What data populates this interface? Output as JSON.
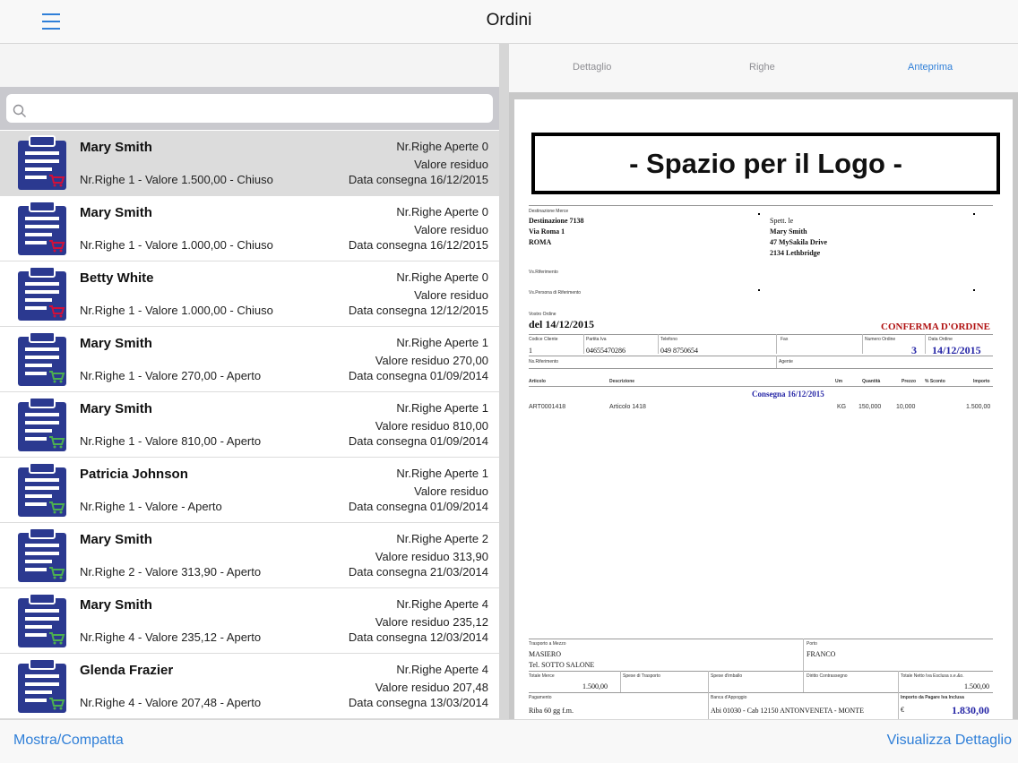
{
  "nav": {
    "title": "Ordini"
  },
  "search": {
    "placeholder": ""
  },
  "orders": [
    {
      "name": "Mary Smith",
      "righe_aperte": "Nr.Righe Aperte 0",
      "residuo": "Valore residuo",
      "summary": "Nr.Righe 1 - Valore 1.500,00 - Chiuso",
      "consegna": "Data consegna 16/12/2015",
      "status": "closed",
      "selected": true
    },
    {
      "name": "Mary Smith",
      "righe_aperte": "Nr.Righe Aperte 0",
      "residuo": "Valore residuo",
      "summary": "Nr.Righe 1 - Valore 1.000,00 - Chiuso",
      "consegna": "Data consegna 16/12/2015",
      "status": "closed",
      "selected": false
    },
    {
      "name": "Betty White",
      "righe_aperte": "Nr.Righe Aperte 0",
      "residuo": "Valore residuo",
      "summary": "Nr.Righe 1 - Valore 1.000,00 - Chiuso",
      "consegna": "Data consegna 12/12/2015",
      "status": "closed",
      "selected": false
    },
    {
      "name": "Mary Smith",
      "righe_aperte": "Nr.Righe Aperte 1",
      "residuo": "Valore residuo 270,00",
      "summary": "Nr.Righe 1 - Valore 270,00 - Aperto",
      "consegna": "Data consegna 01/09/2014",
      "status": "open",
      "selected": false
    },
    {
      "name": "Mary Smith",
      "righe_aperte": "Nr.Righe Aperte 1",
      "residuo": "Valore residuo 810,00",
      "summary": "Nr.Righe 1 - Valore 810,00 - Aperto",
      "consegna": "Data consegna 01/09/2014",
      "status": "open",
      "selected": false
    },
    {
      "name": "Patricia Johnson",
      "righe_aperte": "Nr.Righe Aperte 1",
      "residuo": "Valore residuo",
      "summary": "Nr.Righe 1 - Valore  - Aperto",
      "consegna": "Data consegna 01/09/2014",
      "status": "open",
      "selected": false
    },
    {
      "name": "Mary Smith",
      "righe_aperte": "Nr.Righe Aperte 2",
      "residuo": "Valore residuo 313,90",
      "summary": "Nr.Righe 2 - Valore 313,90 - Aperto",
      "consegna": "Data consegna 21/03/2014",
      "status": "open",
      "selected": false
    },
    {
      "name": "Mary Smith",
      "righe_aperte": "Nr.Righe Aperte 4",
      "residuo": "Valore residuo 235,12",
      "summary": "Nr.Righe 4 - Valore 235,12 - Aperto",
      "consegna": "Data consegna 12/03/2014",
      "status": "open",
      "selected": false
    },
    {
      "name": "Glenda Frazier",
      "righe_aperte": "Nr.Righe Aperte 4",
      "residuo": "Valore residuo 207,48",
      "summary": "Nr.Righe 4 - Valore 207,48 - Aperto",
      "consegna": "Data consegna 13/03/2014",
      "status": "open",
      "selected": false
    }
  ],
  "tabs": {
    "dettaglio": "Dettaglio",
    "righe": "Righe",
    "anteprima": "Anteprima"
  },
  "doc": {
    "logo": "- Spazio per il Logo -",
    "dest_label": "Destinazione Merce",
    "dest_name": "Destinazione 7138",
    "dest_street": "Via Roma 1",
    "dest_city": "ROMA",
    "spett_label": "Spett. le",
    "cust_name": "Mary Smith",
    "cust_street": "47 MySakila Drive",
    "cust_city": "2134 Lethbridge",
    "vs_rif": "Vs.Riferimento",
    "vs_persona": "Vs.Persona di Riferimento",
    "vostro_ordine": "Vostro Ordine",
    "ordine_date": "del 14/12/2015",
    "conferma": "CONFERMA D'ORDINE",
    "h_codice": "Codice Cliente",
    "h_piva": "Partita Iva",
    "h_tel": "Telefono",
    "h_fax": "Fax",
    "h_numero": "Numero Ordine",
    "h_data": "Data Ordine",
    "codice": "1",
    "piva": "04655470286",
    "tel": "049 8750654",
    "numero": "3",
    "data": "14/12/2015",
    "ns_rif": "Ns.Riferimento",
    "agente": "Agente",
    "c_articolo": "Articolo",
    "c_descrizione": "Descrizione",
    "c_um": "Um",
    "c_quantita": "Quantità",
    "c_prezzo": "Prezzo",
    "c_sconto": "% Sconto",
    "c_importo": "Importo",
    "consegna": "Consegna 16/12/2015",
    "line_art": "ART0001418",
    "line_desc": "Articolo 1418",
    "line_um": "KG",
    "line_qty": "150,000",
    "line_prezzo": "10,000",
    "line_importo": "1.500,00",
    "trasporto_label": "Trasporto a Mezzo",
    "trasporto": "MASIERO",
    "tel_sotto": "Tel. SOTTO SALONE",
    "porto_label": "Porto",
    "porto": "FRANCO",
    "f_totale_merce": "Totale Merce",
    "f_spese_trasporto": "Spese di Trasporto",
    "f_spese_imballo": "Spese d'imballo",
    "f_diritto": "Diritto Contrassegno",
    "f_totale_netto": "Totale Netto Iva Esclusa s.e.&o.",
    "totale_merce": "1.500,00",
    "totale_netto": "1.500,00",
    "pagamento_label": "Pagamento",
    "pagamento": "Riba 60 gg f.m.",
    "banca_label": "Banca d'Appoggio",
    "banca": "Abi 01030 - Cab 12150   ANTONVENETA - MONTE",
    "importo_label": "Importo da Pagare Iva Inclusa",
    "euro": "€",
    "importo": "1.830,00"
  },
  "toolbar": {
    "left": "Mostra/Compatta",
    "right": "Visualizza Dettaglio"
  },
  "colors": {
    "accent": "#2f7fd8",
    "icon_blue": "#2b3990",
    "closed_cart": "#d0103a",
    "open_cart": "#4caf50"
  }
}
